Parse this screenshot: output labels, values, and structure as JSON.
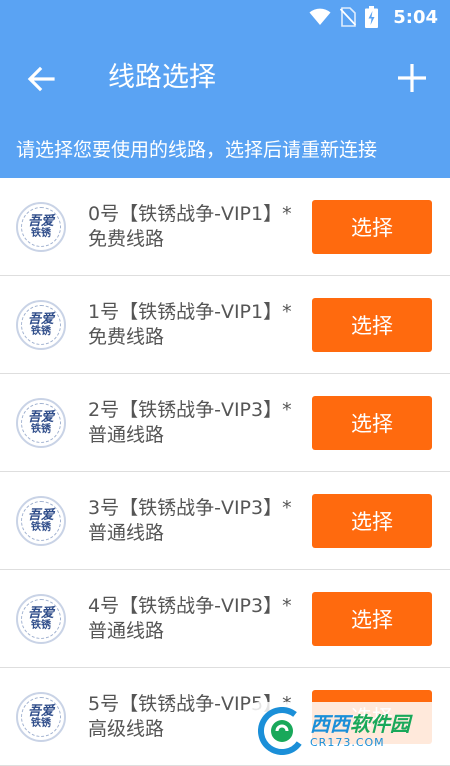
{
  "status_bar": {
    "time": "5:04",
    "icons": [
      "wifi-icon",
      "no-sim-icon",
      "battery-charging-icon"
    ]
  },
  "toolbar": {
    "title": "线路选择",
    "back_icon": "arrow-left-icon",
    "add_icon": "plus-icon"
  },
  "subheader": {
    "text": "请选择您要使用的线路，选择后请重新连接"
  },
  "avatar": {
    "line1": "吾爱",
    "line2": "铁锈"
  },
  "routes": [
    {
      "title": "0号【铁锈战争-VIP1】*",
      "subtitle": "免费线路",
      "button": "选择"
    },
    {
      "title": "1号【铁锈战争-VIP1】*",
      "subtitle": "免费线路",
      "button": "选择"
    },
    {
      "title": "2号【铁锈战争-VIP3】*",
      "subtitle": "普通线路",
      "button": "选择"
    },
    {
      "title": "3号【铁锈战争-VIP3】*",
      "subtitle": "普通线路",
      "button": "选择"
    },
    {
      "title": "4号【铁锈战争-VIP3】*",
      "subtitle": "普通线路",
      "button": "选择"
    },
    {
      "title": "5号【铁锈战争-VIP5】*",
      "subtitle": "高级线路",
      "button": "选择"
    }
  ],
  "watermark": {
    "name_part1": "西西",
    "name_part2": "软件园",
    "url": "CR173.COM"
  },
  "colors": {
    "primary": "#5aa3f3",
    "button": "#ff6a0e",
    "text": "#555555",
    "background": "#f4f4f4"
  }
}
